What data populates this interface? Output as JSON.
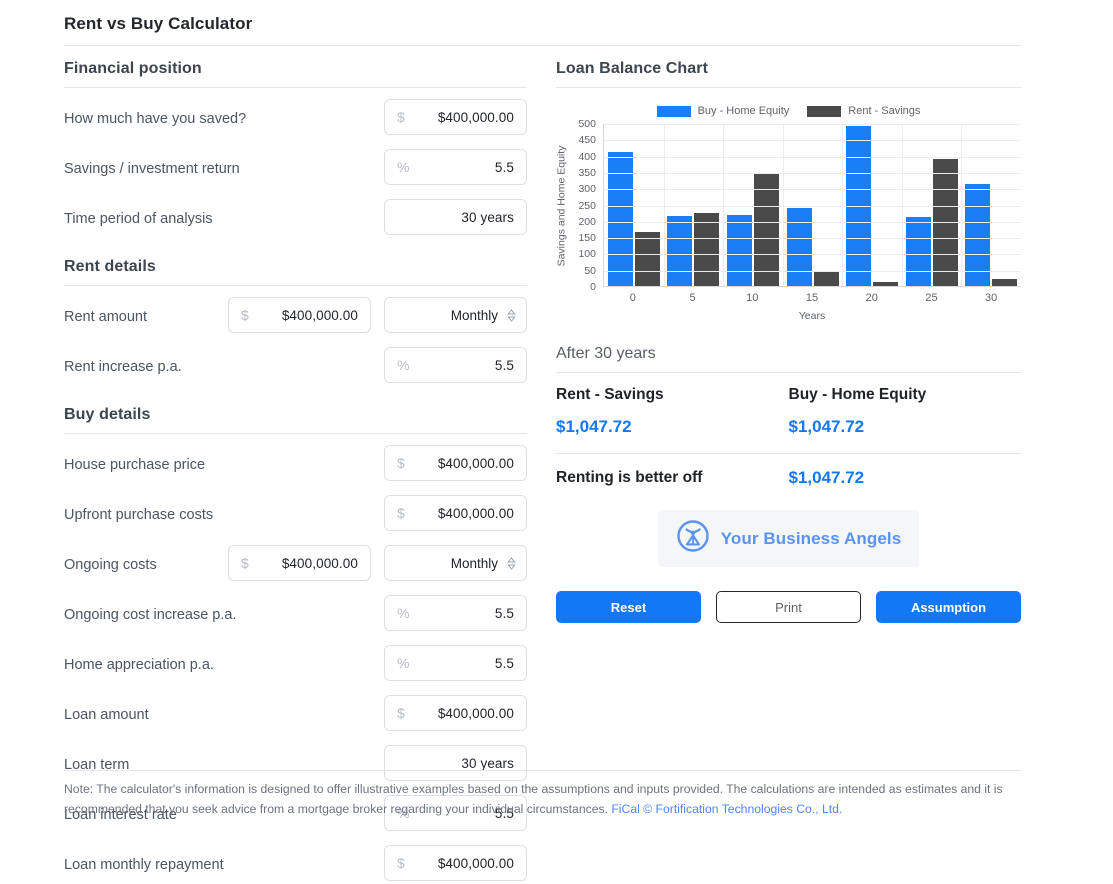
{
  "app": {
    "title": "Rent vs Buy Calculator"
  },
  "colors": {
    "accent": "#1378f5",
    "series_buy": "#1a7ef5",
    "series_rent": "#4a4a4a",
    "brand_blue": "#5b93f0",
    "link": "#4f86f7"
  },
  "sections": {
    "financial_position": {
      "heading": "Financial position",
      "rows": [
        {
          "label": "How much have you saved?",
          "unit": "$",
          "value": "$400,000.00",
          "type": "currency"
        },
        {
          "label": "Savings / investment return",
          "unit": "%",
          "value": "5.5",
          "type": "percent"
        },
        {
          "label": "Time period of analysis",
          "unit": "",
          "value": "30 years",
          "type": "plain"
        }
      ]
    },
    "rent_details": {
      "heading": "Rent details",
      "rows": [
        {
          "label": "Rent amount",
          "unit": "$",
          "value": "$400,000.00",
          "type": "currency",
          "select": "Monthly"
        },
        {
          "label": "Rent increase p.a.",
          "unit": "%",
          "value": "5.5",
          "type": "percent"
        }
      ]
    },
    "buy_details": {
      "heading": "Buy details",
      "rows": [
        {
          "label": "House purchase price",
          "unit": "$",
          "value": "$400,000.00",
          "type": "currency"
        },
        {
          "label": "Upfront purchase costs",
          "unit": "$",
          "value": "$400,000.00",
          "type": "currency"
        },
        {
          "label": "Ongoing costs",
          "unit": "$",
          "value": "$400,000.00",
          "type": "currency",
          "select": "Monthly"
        },
        {
          "label": "Ongoing cost increase p.a.",
          "unit": "%",
          "value": "5.5",
          "type": "percent"
        },
        {
          "label": "Home appreciation p.a.",
          "unit": "%",
          "value": "5.5",
          "type": "percent"
        },
        {
          "label": "Loan amount",
          "unit": "$",
          "value": "$400,000.00",
          "type": "currency"
        },
        {
          "label": "Loan term",
          "unit": "",
          "value": "30 years",
          "type": "plain"
        },
        {
          "label": "Loan interest rate",
          "unit": "%",
          "value": "5.5",
          "type": "percent"
        },
        {
          "label": "Loan monthly repayment",
          "unit": "$",
          "value": "$400,000.00",
          "type": "currency"
        }
      ]
    }
  },
  "chart_panel": {
    "heading": "Loan Balance Chart"
  },
  "chart_data": {
    "type": "bar",
    "title": "",
    "xlabel": "Years",
    "ylabel": "Savings and Home Equity",
    "categories": [
      "0",
      "5",
      "10",
      "15",
      "20",
      "25",
      "30"
    ],
    "series": [
      {
        "name": "Buy - Home Equity",
        "color": "#1a7ef5",
        "values": [
          410,
          216,
          217,
          240,
          490,
          212,
          314
        ]
      },
      {
        "name": "Rent - Savings",
        "color": "#4a4a4a",
        "values": [
          166,
          225,
          346,
          45,
          11,
          389,
          21
        ]
      }
    ],
    "ylim": [
      0,
      500
    ],
    "yticks": [
      0,
      50,
      100,
      150,
      200,
      250,
      300,
      350,
      400,
      450,
      500
    ],
    "grid": true,
    "legend_position": "top"
  },
  "results": {
    "heading": "After 30 years",
    "columns": [
      {
        "name": "Rent - Savings",
        "amount": "$1,047.72"
      },
      {
        "name": "Buy - Home Equity",
        "amount": "$1,047.72"
      }
    ],
    "verdict_label": "Renting is better off",
    "verdict_amount": "$1,047.72"
  },
  "brand": {
    "name": "Your Business Angels",
    "icon": "angel-logo-icon"
  },
  "buttons": [
    {
      "label": "Reset",
      "style": "primary",
      "name": "reset-button"
    },
    {
      "label": "Print",
      "style": "ghost",
      "name": "print-button"
    },
    {
      "label": "Assumption",
      "style": "primary",
      "name": "assumption-button"
    }
  ],
  "footer": {
    "note_part1": "Note: The calculator's information is designed to offer illustrative examples based on the assumptions and inputs provided. The calculations are intended as estimates and it is recommended that you seek advice from a mortgage broker regarding your individual circumstances. ",
    "link": "FiCal © Fortification Technologies Co., Ltd."
  }
}
